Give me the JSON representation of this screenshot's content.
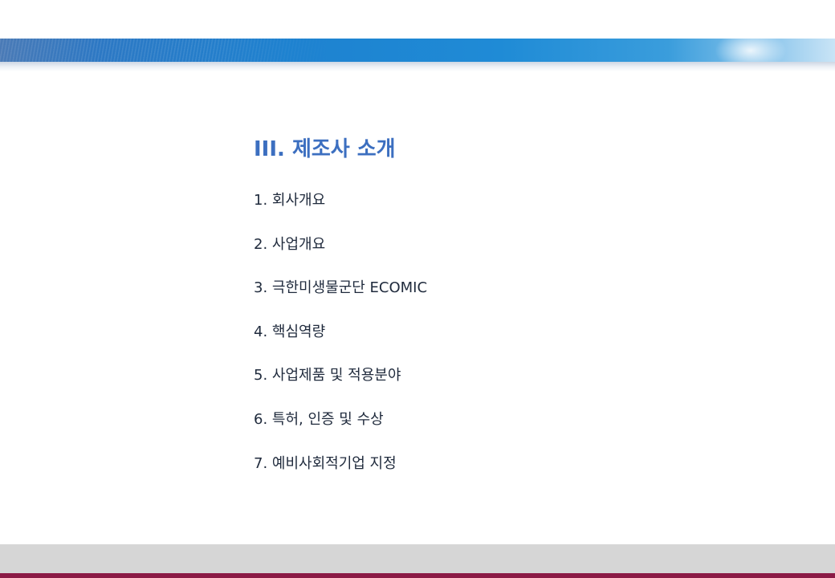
{
  "colors": {
    "header_band": "#1e82d0",
    "title": "#3c6fc0",
    "body_text": "#1f2a3c",
    "footer_band": "#d6d6d6",
    "footer_line": "#8b1a45"
  },
  "section_title": "III. 제조사 소개",
  "toc_items": [
    "1. 회사개요",
    "2. 사업개요",
    "3. 극한미생물군단 ECOMIC",
    "4. 핵심역량",
    "5. 사업제품 및 적용분야",
    "6. 특허, 인증 및 수상",
    "7. 예비사회적기업 지정"
  ]
}
